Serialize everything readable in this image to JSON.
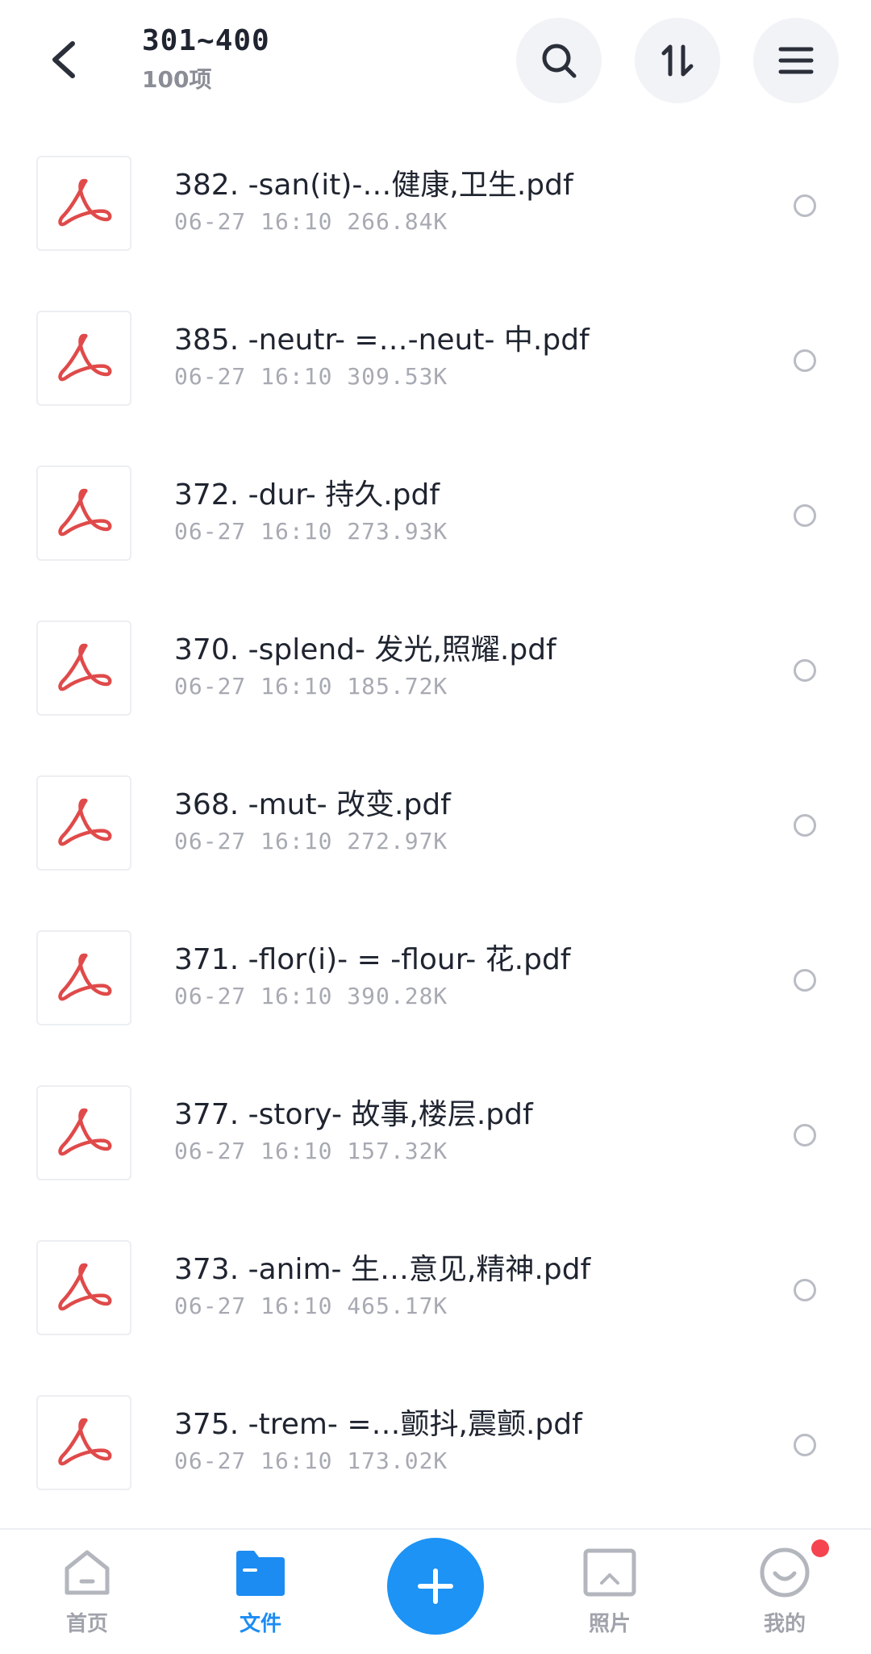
{
  "header": {
    "title": "301~400",
    "subtitle": "100项",
    "back_icon": "chevron-left-icon",
    "actions": [
      "search-icon",
      "sort-icon",
      "menu-icon"
    ]
  },
  "files": [
    {
      "name": "382. -san(it)-…健康,卫生.pdf",
      "meta": "06-27 16:10 266.84K"
    },
    {
      "name": "385. -neutr- =…-neut- 中.pdf",
      "meta": "06-27 16:10 309.53K"
    },
    {
      "name": "372. -dur- 持久.pdf",
      "meta": "06-27 16:10 273.93K"
    },
    {
      "name": "370. -splend- 发光,照耀.pdf",
      "meta": "06-27 16:10 185.72K"
    },
    {
      "name": "368. -mut- 改变.pdf",
      "meta": "06-27 16:10 272.97K"
    },
    {
      "name": "371. -flor(i)- = -flour- 花.pdf",
      "meta": "06-27 16:10 390.28K"
    },
    {
      "name": "377. -story- 故事,楼层.pdf",
      "meta": "06-27 16:10 157.32K"
    },
    {
      "name": "373. -anim- 生…意见,精神.pdf",
      "meta": "06-27 16:10 465.17K"
    },
    {
      "name": "375. -trem- =…颤抖,震颤.pdf",
      "meta": "06-27 16:10 173.02K"
    }
  ],
  "nav": {
    "home": "首页",
    "files": "文件",
    "photos": "照片",
    "me": "我的"
  },
  "colors": {
    "accent": "#1c93f5",
    "pdf_red": "#e04a4a",
    "badge": "#f5444f"
  }
}
